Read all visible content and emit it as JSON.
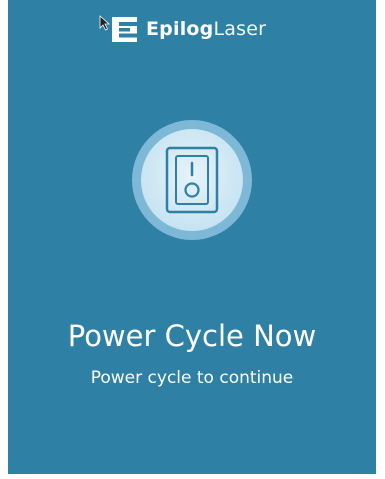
{
  "brand": {
    "name_strong": "Epilog",
    "name_light": "Laser",
    "logo_icon": "epilog-e-logo-icon"
  },
  "status_icon": "power-switch-icon",
  "message": {
    "title": "Power Cycle Now",
    "subtitle": "Power cycle to continue"
  },
  "colors": {
    "background": "#2e80a4",
    "icon_ring": "#7db9d7",
    "icon_fill": "#cde6f3",
    "icon_stroke": "#2e80a4",
    "text": "#ffffff"
  }
}
